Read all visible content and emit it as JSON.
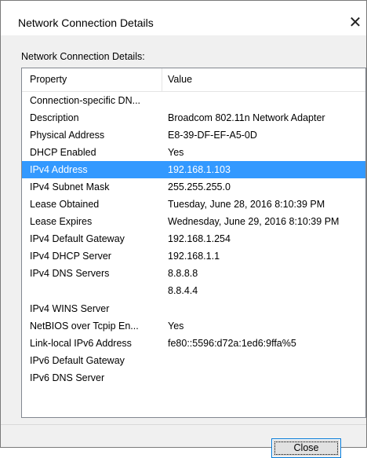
{
  "window": {
    "title": "Network Connection Details",
    "close_glyph": "✕"
  },
  "group_label": "Network Connection Details:",
  "columns": {
    "property": "Property",
    "value": "Value"
  },
  "rows": [
    {
      "property": "Connection-specific DN...",
      "value": ""
    },
    {
      "property": "Description",
      "value": "Broadcom 802.11n Network Adapter"
    },
    {
      "property": "Physical Address",
      "value": "E8-39-DF-EF-A5-0D"
    },
    {
      "property": "DHCP Enabled",
      "value": "Yes"
    },
    {
      "property": "IPv4 Address",
      "value": "192.168.1.103",
      "selected": true
    },
    {
      "property": "IPv4 Subnet Mask",
      "value": "255.255.255.0"
    },
    {
      "property": "Lease Obtained",
      "value": "Tuesday, June 28, 2016 8:10:39 PM"
    },
    {
      "property": "Lease Expires",
      "value": "Wednesday, June 29, 2016 8:10:39 PM"
    },
    {
      "property": "IPv4 Default Gateway",
      "value": "192.168.1.254"
    },
    {
      "property": "IPv4 DHCP Server",
      "value": "192.168.1.1"
    },
    {
      "property": "IPv4 DNS Servers",
      "value": "8.8.8.8",
      "value2": "8.8.4.4"
    },
    {
      "property": "IPv4 WINS Server",
      "value": ""
    },
    {
      "property": "NetBIOS over Tcpip En...",
      "value": "Yes"
    },
    {
      "property": "Link-local IPv6 Address",
      "value": "fe80::5596:d72a:1ed6:9ffa%5"
    },
    {
      "property": "IPv6 Default Gateway",
      "value": ""
    },
    {
      "property": "IPv6 DNS Server",
      "value": ""
    }
  ],
  "buttons": {
    "close": "Close"
  },
  "colors": {
    "selection": "#3399ff",
    "button_border": "#0078d7"
  }
}
